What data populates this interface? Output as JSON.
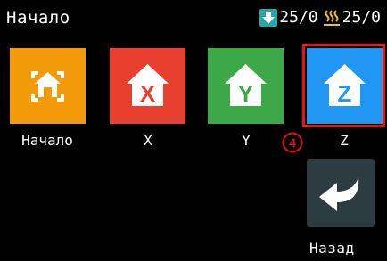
{
  "header": {
    "title": "Начало",
    "bed_temp": "25/0",
    "nozzle_temp": "25/0"
  },
  "tiles": [
    {
      "label": "Начало",
      "letter": "",
      "color": "#f39a0b",
      "icon": "home-all-icon"
    },
    {
      "label": "X",
      "letter": "X",
      "color": "#e8402f",
      "icon": "home-x-icon"
    },
    {
      "label": "Y",
      "letter": "Y",
      "color": "#3da847",
      "icon": "home-y-icon"
    },
    {
      "label": "Z",
      "letter": "Z",
      "color": "#2196f3",
      "icon": "home-z-icon"
    }
  ],
  "annotation": {
    "marker": "4",
    "color": "#e11111"
  },
  "back": {
    "label": "Назад",
    "color": "#2d3c41",
    "icon": "back-arrow-icon"
  }
}
